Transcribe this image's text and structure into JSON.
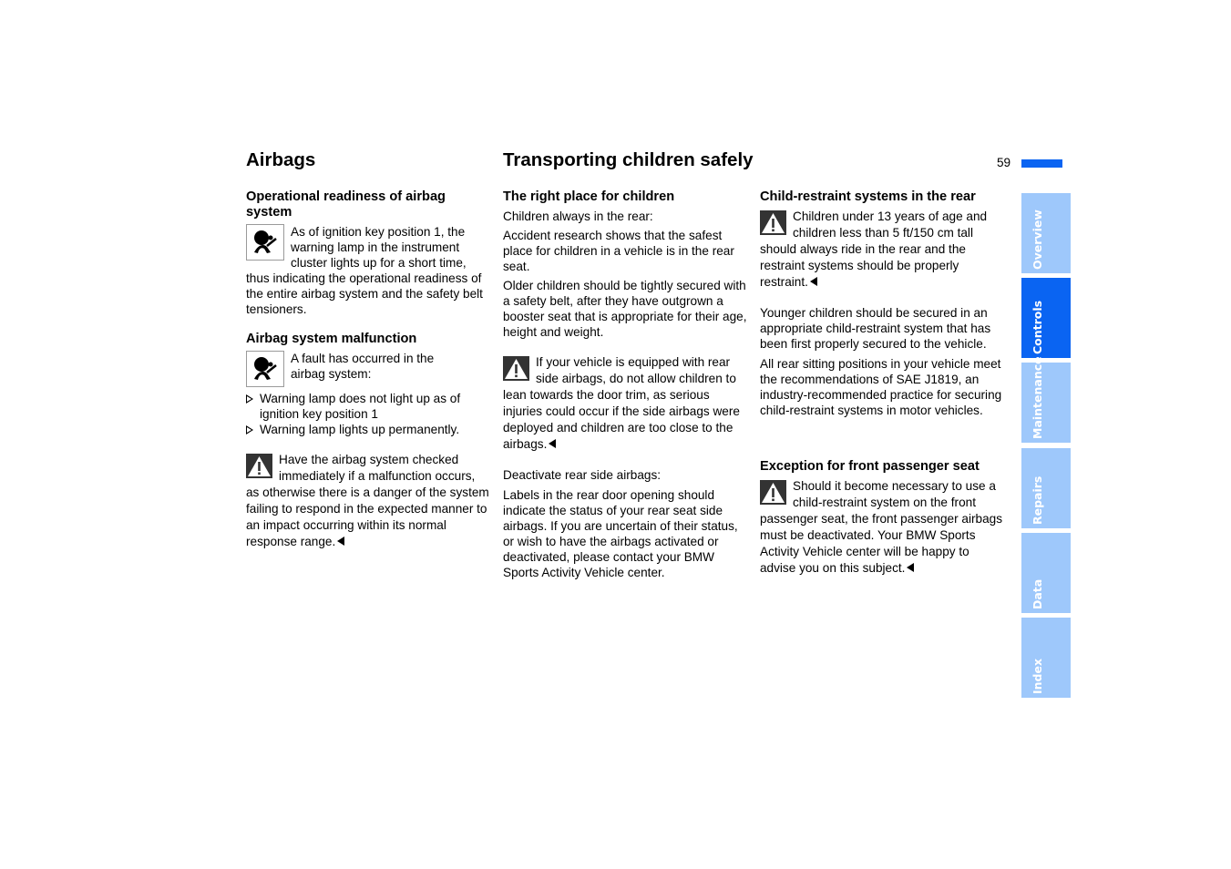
{
  "page_number": "59",
  "columns": {
    "left": {
      "title": "Airbags",
      "sections": [
        {
          "heading": "Operational readiness of airbag system",
          "icon": "airbag-warning-lamp-icon",
          "text": "As of ignition key position 1, the warning lamp in the instrument cluster lights up for a short time, thus indicating the operational readiness of the entire airbag system and the safety belt tensioners."
        },
        {
          "heading": "Airbag system malfunction",
          "icon": "airbag-warning-lamp-icon",
          "text": "A fault has occurred in the airbag system:",
          "bullets": [
            "Warning lamp does not light up as of ignition key position 1",
            "Warning lamp lights up permanently."
          ],
          "warning": "Have the airbag system checked immediately if a malfunction occurs, as otherwise there is a danger of the system failing to respond in the expected manner to an impact occurring within its normal response range."
        }
      ]
    },
    "middle": {
      "title": "Transporting children safely",
      "sections": [
        {
          "heading": "The right place for children",
          "paragraphs": [
            "Children always in the rear:",
            "Accident research shows that the safest place for children in a vehicle is in the rear seat.",
            "Older children should be tightly secured with a safety belt, after they have outgrown a booster seat that is appropriate for their age, height and weight."
          ],
          "warning": "If your vehicle is equipped with rear side airbags, do not allow children to lean towards the door trim, as serious injuries could occur if the side airbags were deployed and children are too close to the airbags.",
          "after_warning": [
            "Deactivate rear side airbags:",
            "Labels in the rear door opening should indicate the status of your rear seat side airbags. If you are uncertain of their status, or wish to have the airbags activated or deactivated, please contact your BMW Sports Activity Vehicle center."
          ]
        }
      ]
    },
    "right": {
      "sections": [
        {
          "heading": "Child-restraint systems in the rear",
          "warning": "Children under 13 years of age and children less than 5 ft/150 cm tall should always ride in the rear and the restraint systems should be properly restraint.",
          "paragraphs": [
            "Younger children should be secured in an appropriate child-restraint system that has been first properly secured to the vehicle.",
            "All rear sitting positions in your vehicle meet the recommendations of SAE J1819, an industry-recommended practice for securing child-restraint systems in motor vehicles."
          ]
        },
        {
          "heading": "Exception for front passenger seat",
          "warning": "Should it become necessary to use a child-restraint system on the front passenger seat, the front passenger airbags must be deactivated. Your BMW Sports Activity Vehicle center will be happy to advise you on this subject."
        }
      ]
    }
  },
  "side_tabs": [
    {
      "label": "Overview",
      "active": false
    },
    {
      "label": "Controls",
      "active": true
    },
    {
      "label": "Maintenance",
      "active": false
    },
    {
      "label": "Repairs",
      "active": false
    },
    {
      "label": "Data",
      "active": false
    },
    {
      "label": "Index",
      "active": false
    }
  ],
  "colors": {
    "accent": "#0a64f2",
    "tab_inactive": "#9ec8fb",
    "warning_icon_bg": "#333333"
  }
}
